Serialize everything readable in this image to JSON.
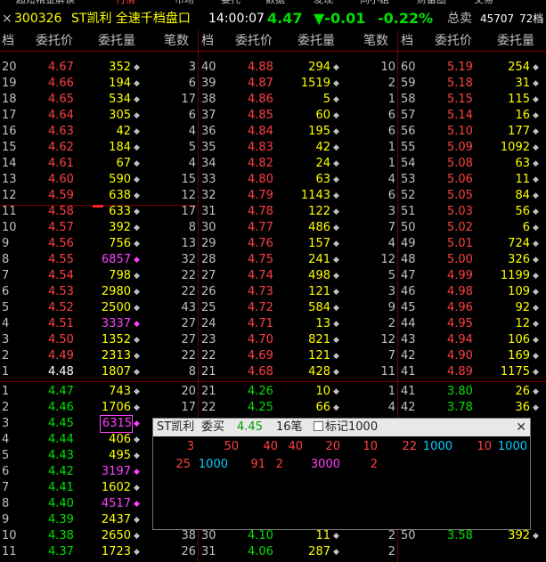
{
  "menu": {
    "items": [
      "超短精金解读",
      "行情",
      "市场",
      "委托",
      "数据",
      "发现",
      "同小姐",
      "财富圈",
      "交易"
    ]
  },
  "title": {
    "close_glyph": "×",
    "code": "300326",
    "name": "ST凯利 全速千档盘口",
    "time": "14:00:07",
    "price": "4.47",
    "change": "▼-0.01",
    "change_pct": "-0.22%",
    "sell_label": "总卖",
    "sell_total": "45707",
    "levels": "72档"
  },
  "header": {
    "col_level": "档",
    "col_price": "委托价",
    "col_volume": "委托量",
    "col_count": "笔数"
  },
  "colors": {
    "red": "#ff4040",
    "green": "#00e000",
    "magenta": "#ff40ff",
    "white": "#ffffff",
    "grid": "#7a0000"
  },
  "asks_col1": [
    {
      "lv": "20",
      "price": "4.67",
      "vol": "352",
      "cnt": "3",
      "vc": "y",
      "pc": "r"
    },
    {
      "lv": "19",
      "price": "4.66",
      "vol": "194",
      "cnt": "6",
      "vc": "y",
      "pc": "r"
    },
    {
      "lv": "18",
      "price": "4.65",
      "vol": "534",
      "cnt": "17",
      "vc": "y",
      "pc": "r"
    },
    {
      "lv": "17",
      "price": "4.64",
      "vol": "305",
      "cnt": "6",
      "vc": "y",
      "pc": "r"
    },
    {
      "lv": "16",
      "price": "4.63",
      "vol": "42",
      "cnt": "4",
      "vc": "y",
      "pc": "r"
    },
    {
      "lv": "15",
      "price": "4.62",
      "vol": "184",
      "cnt": "5",
      "vc": "y",
      "pc": "r"
    },
    {
      "lv": "14",
      "price": "4.61",
      "vol": "67",
      "cnt": "4",
      "vc": "y",
      "pc": "r"
    },
    {
      "lv": "13",
      "price": "4.60",
      "vol": "590",
      "cnt": "15",
      "vc": "y",
      "pc": "r"
    },
    {
      "lv": "12",
      "price": "4.59",
      "vol": "638",
      "cnt": "12",
      "vc": "y",
      "pc": "r"
    },
    {
      "lv": "11",
      "price": "4.58",
      "vol": "633",
      "cnt": "17",
      "vc": "y",
      "pc": "r"
    },
    {
      "lv": "10",
      "price": "4.57",
      "vol": "392",
      "cnt": "8",
      "vc": "y",
      "pc": "r"
    },
    {
      "lv": "9",
      "price": "4.56",
      "vol": "756",
      "cnt": "13",
      "vc": "y",
      "pc": "r"
    },
    {
      "lv": "8",
      "price": "4.55",
      "vol": "6857",
      "cnt": "32",
      "vc": "m",
      "pc": "r"
    },
    {
      "lv": "7",
      "price": "4.54",
      "vol": "798",
      "cnt": "22",
      "vc": "y",
      "pc": "r"
    },
    {
      "lv": "6",
      "price": "4.53",
      "vol": "2980",
      "cnt": "22",
      "vc": "y",
      "pc": "r"
    },
    {
      "lv": "5",
      "price": "4.52",
      "vol": "2500",
      "cnt": "43",
      "vc": "y",
      "pc": "r"
    },
    {
      "lv": "4",
      "price": "4.51",
      "vol": "3337",
      "cnt": "27",
      "vc": "m",
      "pc": "r"
    },
    {
      "lv": "3",
      "price": "4.50",
      "vol": "1352",
      "cnt": "27",
      "vc": "y",
      "pc": "r"
    },
    {
      "lv": "2",
      "price": "4.49",
      "vol": "2313",
      "cnt": "22",
      "vc": "y",
      "pc": "r"
    },
    {
      "lv": "1",
      "price": "4.48",
      "vol": "1807",
      "cnt": "8",
      "vc": "y",
      "pc": "w"
    }
  ],
  "asks_col2": [
    {
      "lv": "40",
      "price": "4.88",
      "vol": "294",
      "cnt": "10",
      "vc": "y",
      "pc": "r"
    },
    {
      "lv": "39",
      "price": "4.87",
      "vol": "1519",
      "cnt": "2",
      "vc": "y",
      "pc": "r"
    },
    {
      "lv": "38",
      "price": "4.86",
      "vol": "5",
      "cnt": "1",
      "vc": "y",
      "pc": "r"
    },
    {
      "lv": "37",
      "price": "4.85",
      "vol": "60",
      "cnt": "6",
      "vc": "y",
      "pc": "r"
    },
    {
      "lv": "36",
      "price": "4.84",
      "vol": "195",
      "cnt": "6",
      "vc": "y",
      "pc": "r"
    },
    {
      "lv": "35",
      "price": "4.83",
      "vol": "42",
      "cnt": "1",
      "vc": "y",
      "pc": "r"
    },
    {
      "lv": "34",
      "price": "4.82",
      "vol": "24",
      "cnt": "1",
      "vc": "y",
      "pc": "r"
    },
    {
      "lv": "33",
      "price": "4.80",
      "vol": "63",
      "cnt": "4",
      "vc": "y",
      "pc": "r"
    },
    {
      "lv": "32",
      "price": "4.79",
      "vol": "1143",
      "cnt": "6",
      "vc": "y",
      "pc": "r"
    },
    {
      "lv": "31",
      "price": "4.78",
      "vol": "122",
      "cnt": "3",
      "vc": "y",
      "pc": "r"
    },
    {
      "lv": "30",
      "price": "4.77",
      "vol": "486",
      "cnt": "7",
      "vc": "y",
      "pc": "r"
    },
    {
      "lv": "29",
      "price": "4.76",
      "vol": "157",
      "cnt": "4",
      "vc": "y",
      "pc": "r"
    },
    {
      "lv": "28",
      "price": "4.75",
      "vol": "241",
      "cnt": "12",
      "vc": "y",
      "pc": "r"
    },
    {
      "lv": "27",
      "price": "4.74",
      "vol": "498",
      "cnt": "5",
      "vc": "y",
      "pc": "r"
    },
    {
      "lv": "26",
      "price": "4.73",
      "vol": "121",
      "cnt": "3",
      "vc": "y",
      "pc": "r"
    },
    {
      "lv": "25",
      "price": "4.72",
      "vol": "584",
      "cnt": "9",
      "vc": "y",
      "pc": "r"
    },
    {
      "lv": "24",
      "price": "4.71",
      "vol": "13",
      "cnt": "2",
      "vc": "y",
      "pc": "r"
    },
    {
      "lv": "23",
      "price": "4.70",
      "vol": "821",
      "cnt": "12",
      "vc": "y",
      "pc": "r"
    },
    {
      "lv": "22",
      "price": "4.69",
      "vol": "121",
      "cnt": "7",
      "vc": "y",
      "pc": "r"
    },
    {
      "lv": "21",
      "price": "4.68",
      "vol": "428",
      "cnt": "11",
      "vc": "y",
      "pc": "r"
    }
  ],
  "asks_col3": [
    {
      "lv": "60",
      "price": "5.19",
      "vol": "254",
      "vc": "y",
      "pc": "r"
    },
    {
      "lv": "59",
      "price": "5.18",
      "vol": "31",
      "vc": "y",
      "pc": "r"
    },
    {
      "lv": "58",
      "price": "5.15",
      "vol": "115",
      "vc": "y",
      "pc": "r"
    },
    {
      "lv": "57",
      "price": "5.14",
      "vol": "16",
      "vc": "y",
      "pc": "r"
    },
    {
      "lv": "56",
      "price": "5.10",
      "vol": "177",
      "vc": "y",
      "pc": "r"
    },
    {
      "lv": "55",
      "price": "5.09",
      "vol": "1092",
      "vc": "y",
      "pc": "r"
    },
    {
      "lv": "54",
      "price": "5.08",
      "vol": "63",
      "vc": "y",
      "pc": "r"
    },
    {
      "lv": "53",
      "price": "5.06",
      "vol": "11",
      "vc": "y",
      "pc": "r"
    },
    {
      "lv": "52",
      "price": "5.05",
      "vol": "84",
      "vc": "y",
      "pc": "r"
    },
    {
      "lv": "51",
      "price": "5.03",
      "vol": "56",
      "vc": "y",
      "pc": "r"
    },
    {
      "lv": "50",
      "price": "5.02",
      "vol": "6",
      "vc": "y",
      "pc": "r"
    },
    {
      "lv": "49",
      "price": "5.01",
      "vol": "724",
      "vc": "y",
      "pc": "r"
    },
    {
      "lv": "48",
      "price": "5.00",
      "vol": "326",
      "vc": "y",
      "pc": "r"
    },
    {
      "lv": "47",
      "price": "4.99",
      "vol": "1199",
      "vc": "y",
      "pc": "r"
    },
    {
      "lv": "46",
      "price": "4.98",
      "vol": "109",
      "vc": "y",
      "pc": "r"
    },
    {
      "lv": "45",
      "price": "4.96",
      "vol": "92",
      "vc": "y",
      "pc": "r"
    },
    {
      "lv": "44",
      "price": "4.95",
      "vol": "12",
      "vc": "y",
      "pc": "r"
    },
    {
      "lv": "43",
      "price": "4.94",
      "vol": "106",
      "vc": "y",
      "pc": "r"
    },
    {
      "lv": "42",
      "price": "4.90",
      "vol": "169",
      "vc": "y",
      "pc": "r"
    },
    {
      "lv": "41",
      "price": "4.89",
      "vol": "1175",
      "vc": "y",
      "pc": "r"
    }
  ],
  "bids_col1": [
    {
      "lv": "1",
      "price": "4.47",
      "vol": "743",
      "cnt": "20",
      "vc": "y",
      "pc": "g"
    },
    {
      "lv": "2",
      "price": "4.46",
      "vol": "1706",
      "cnt": "17",
      "vc": "y",
      "pc": "g"
    },
    {
      "lv": "3",
      "price": "4.45",
      "vol": "6315",
      "cnt": "",
      "vc": "m",
      "pc": "g",
      "boxed": true
    },
    {
      "lv": "4",
      "price": "4.44",
      "vol": "406",
      "cnt": "",
      "vc": "y",
      "pc": "g"
    },
    {
      "lv": "5",
      "price": "4.43",
      "vol": "495",
      "cnt": "",
      "vc": "y",
      "pc": "g"
    },
    {
      "lv": "6",
      "price": "4.42",
      "vol": "3197",
      "cnt": "",
      "vc": "m",
      "pc": "g"
    },
    {
      "lv": "7",
      "price": "4.41",
      "vol": "1602",
      "cnt": "",
      "vc": "y",
      "pc": "g"
    },
    {
      "lv": "8",
      "price": "4.40",
      "vol": "4517",
      "cnt": "",
      "vc": "m",
      "pc": "g"
    },
    {
      "lv": "9",
      "price": "4.39",
      "vol": "2437",
      "cnt": "",
      "vc": "y",
      "pc": "g"
    },
    {
      "lv": "10",
      "price": "4.38",
      "vol": "2650",
      "cnt": "38",
      "vc": "y",
      "pc": "g"
    },
    {
      "lv": "11",
      "price": "4.37",
      "vol": "1723",
      "cnt": "26",
      "vc": "y",
      "pc": "g"
    }
  ],
  "bids_col2": [
    {
      "lv": "21",
      "price": "4.26",
      "vol": "10",
      "cnt": "1",
      "vc": "y",
      "pc": "g"
    },
    {
      "lv": "22",
      "price": "4.25",
      "vol": "66",
      "cnt": "4",
      "vc": "y",
      "pc": "g"
    },
    {
      "lv": "",
      "price": "",
      "vol": "",
      "cnt": "",
      "vc": "y",
      "pc": "g"
    },
    {
      "lv": "",
      "price": "",
      "vol": "",
      "cnt": "",
      "vc": "y",
      "pc": "g"
    },
    {
      "lv": "",
      "price": "",
      "vol": "",
      "cnt": "",
      "vc": "y",
      "pc": "g"
    },
    {
      "lv": "",
      "price": "",
      "vol": "",
      "cnt": "",
      "vc": "y",
      "pc": "g"
    },
    {
      "lv": "",
      "price": "",
      "vol": "",
      "cnt": "",
      "vc": "y",
      "pc": "g"
    },
    {
      "lv": "",
      "price": "",
      "vol": "",
      "cnt": "",
      "vc": "y",
      "pc": "g"
    },
    {
      "lv": "",
      "price": "",
      "vol": "",
      "cnt": "",
      "vc": "y",
      "pc": "g"
    },
    {
      "lv": "30",
      "price": "4.10",
      "vol": "11",
      "cnt": "2",
      "vc": "y",
      "pc": "g"
    },
    {
      "lv": "31",
      "price": "4.06",
      "vol": "287",
      "cnt": "2",
      "vc": "y",
      "pc": "g"
    }
  ],
  "bids_col3": [
    {
      "lv": "41",
      "price": "3.80",
      "vol": "26",
      "vc": "y",
      "pc": "g"
    },
    {
      "lv": "42",
      "price": "3.78",
      "vol": "36",
      "vc": "y",
      "pc": "g"
    },
    {
      "lv": "",
      "price": "",
      "vol": "",
      "vc": "y",
      "pc": "g"
    },
    {
      "lv": "",
      "price": "",
      "vol": "",
      "vc": "y",
      "pc": "g"
    },
    {
      "lv": "",
      "price": "",
      "vol": "",
      "vc": "y",
      "pc": "g"
    },
    {
      "lv": "",
      "price": "",
      "vol": "",
      "vc": "y",
      "pc": "g"
    },
    {
      "lv": "",
      "price": "",
      "vol": "",
      "vc": "y",
      "pc": "g"
    },
    {
      "lv": "",
      "price": "",
      "vol": "",
      "vc": "y",
      "pc": "g"
    },
    {
      "lv": "",
      "price": "",
      "vol": "",
      "vc": "y",
      "pc": "g"
    },
    {
      "lv": "50",
      "price": "3.58",
      "vol": "392",
      "vc": "y",
      "pc": "g"
    },
    {
      "lv": "",
      "price": "",
      "vol": "",
      "vc": "y",
      "pc": "g"
    }
  ],
  "popup": {
    "name": "ST凯利",
    "side": "委买",
    "price": "4.45",
    "orders": "16笔",
    "mark_label": "标记1000",
    "close_glyph": "✕",
    "row1": [
      "3",
      "50",
      "40",
      "40",
      "20",
      "10",
      "22",
      "1000",
      "10",
      "1000"
    ],
    "row2": [
      "25",
      "1000",
      "91",
      "2",
      "3000",
      "2"
    ]
  }
}
